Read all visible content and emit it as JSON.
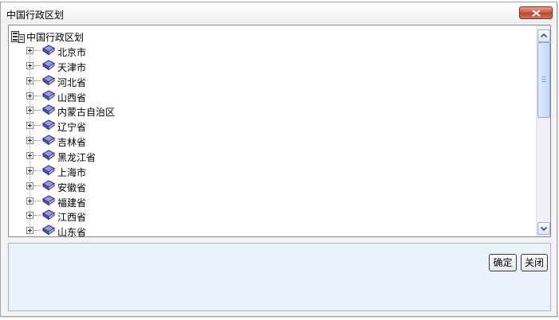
{
  "dialog": {
    "title": "中国行政区划",
    "close_label": "x"
  },
  "tree": {
    "root_label": "中国行政区划",
    "items": [
      {
        "label": "北京市"
      },
      {
        "label": "天津市"
      },
      {
        "label": "河北省"
      },
      {
        "label": "山西省"
      },
      {
        "label": "内蒙古自治区"
      },
      {
        "label": "辽宁省"
      },
      {
        "label": "吉林省"
      },
      {
        "label": "黑龙江省"
      },
      {
        "label": "上海市"
      },
      {
        "label": "安徽省"
      },
      {
        "label": "福建省"
      },
      {
        "label": "江西省"
      },
      {
        "label": "山东省"
      }
    ]
  },
  "buttons": {
    "ok_label": "确定",
    "close_label": "关闭"
  },
  "colors": {
    "close_button": "#c65640",
    "bottom_panel": "#eaf2fb",
    "book_icon": "#6d7fd8"
  },
  "icons": {
    "root": "tree-root-icon",
    "node": "book-icon",
    "expander": "plus-box-icon"
  }
}
